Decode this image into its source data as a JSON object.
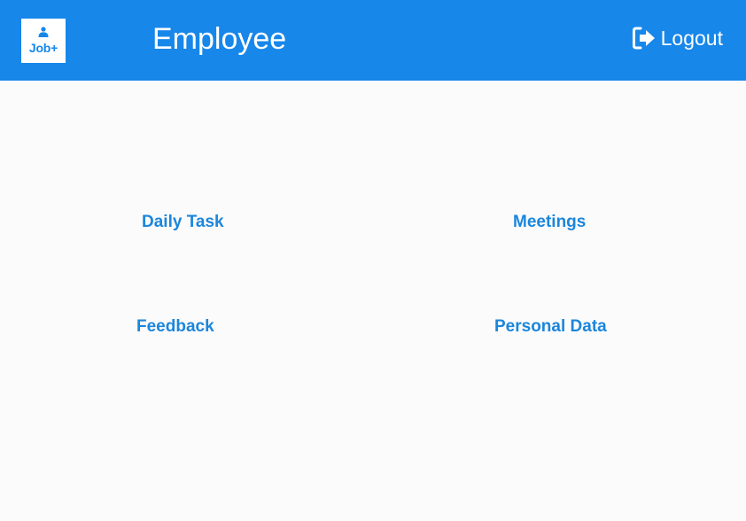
{
  "header": {
    "logo_text": "Job+",
    "logo_icon": "user-icon",
    "title": "Employee",
    "logout_label": "Logout",
    "logout_icon": "logout-icon",
    "background_color": "#1787ea"
  },
  "menu": {
    "daily_task": "Daily Task",
    "meetings": "Meetings",
    "feedback": "Feedback",
    "personal_data": "Personal Data",
    "text_color": "#1b86db"
  }
}
